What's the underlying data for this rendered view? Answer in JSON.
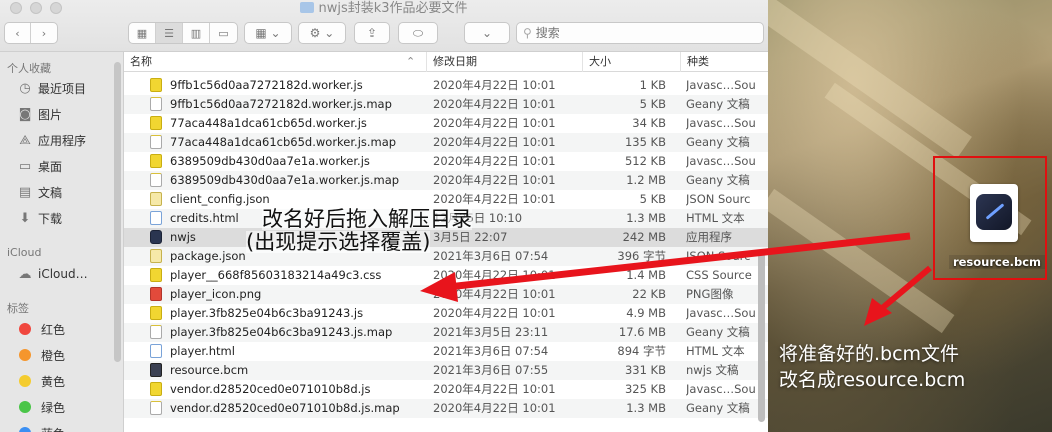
{
  "window": {
    "title": "nwjs封装k3作品必要文件",
    "search_placeholder": "搜索",
    "toolbar_icons": [
      "back-icon",
      "forward-icon",
      "icon-view-icon",
      "list-view-icon",
      "column-view-icon",
      "gallery-view-icon",
      "group-icon",
      "action-gear-icon",
      "share-icon",
      "tag-icon"
    ]
  },
  "sidebar": {
    "favorites_header": "个人收藏",
    "favorites": [
      {
        "label": "最近项目",
        "icon": "clock-icon"
      },
      {
        "label": "图片",
        "icon": "camera-icon"
      },
      {
        "label": "应用程序",
        "icon": "apps-icon"
      },
      {
        "label": "桌面",
        "icon": "desktop-icon"
      },
      {
        "label": "文稿",
        "icon": "document-icon"
      },
      {
        "label": "下载",
        "icon": "download-icon"
      }
    ],
    "icloud_header": "iCloud",
    "icloud_items": [
      {
        "label": "iCloud…",
        "icon": "cloud-icon"
      }
    ],
    "tags_header": "标签",
    "tags": [
      {
        "label": "红色",
        "color": "#f0473e"
      },
      {
        "label": "橙色",
        "color": "#f5962d"
      },
      {
        "label": "黄色",
        "color": "#f4cc2f"
      },
      {
        "label": "绿色",
        "color": "#4ac548"
      },
      {
        "label": "蓝色",
        "color": "#3b8ff3"
      }
    ]
  },
  "columns": {
    "name": "名称",
    "date": "修改日期",
    "size": "大小",
    "kind": "种类"
  },
  "files": [
    {
      "name": "9ffb1c56d0aa7272182d.worker.js",
      "date": "2020年4月22日 10:01",
      "size": "1 KB",
      "kind": "Javasc…Sou",
      "icon": "js"
    },
    {
      "name": "9ffb1c56d0aa7272182d.worker.js.map",
      "date": "2020年4月22日 10:01",
      "size": "5 KB",
      "kind": "Geany 文稿",
      "icon": "map"
    },
    {
      "name": "77aca448a1dca61cb65d.worker.js",
      "date": "2020年4月22日 10:01",
      "size": "34 KB",
      "kind": "Javasc…Sou",
      "icon": "js"
    },
    {
      "name": "77aca448a1dca61cb65d.worker.js.map",
      "date": "2020年4月22日 10:01",
      "size": "135 KB",
      "kind": "Geany 文稿",
      "icon": "map"
    },
    {
      "name": "6389509db430d0aa7e1a.worker.js",
      "date": "2020年4月22日 10:01",
      "size": "512 KB",
      "kind": "Javasc…Sou",
      "icon": "js"
    },
    {
      "name": "6389509db430d0aa7e1a.worker.js.map",
      "date": "2020年4月22日 10:01",
      "size": "1.2 MB",
      "kind": "Geany 文稿",
      "icon": "map"
    },
    {
      "name": "client_config.json",
      "date": "2020年4月22日 10:01",
      "size": "5 KB",
      "kind": "JSON Sourc",
      "icon": "json"
    },
    {
      "name": "credits.html",
      "date": "12月25日 10:10",
      "size": "1.3 MB",
      "kind": "HTML 文本",
      "icon": "html"
    },
    {
      "name": "nwjs",
      "date": "3月5日 22:07",
      "size": "242 MB",
      "kind": "应用程序",
      "icon": "app"
    },
    {
      "name": "package.json",
      "date": "2021年3月6日 07:54",
      "size": "396 字节",
      "kind": "JSON Sourc",
      "icon": "json"
    },
    {
      "name": "player__668f85603183214a49c3.css",
      "date": "2020年4月22日 10:01",
      "size": "1.4 MB",
      "kind": "CSS Source",
      "icon": "css"
    },
    {
      "name": "player_icon.png",
      "date": "2020年4月22日 10:01",
      "size": "22 KB",
      "kind": "PNG图像",
      "icon": "png"
    },
    {
      "name": "player.3fb825e04b6c3ba91243.js",
      "date": "2020年4月22日 10:01",
      "size": "4.9 MB",
      "kind": "Javasc…Sou",
      "icon": "js"
    },
    {
      "name": "player.3fb825e04b6c3ba91243.js.map",
      "date": "2021年3月5日 23:11",
      "size": "17.6 MB",
      "kind": "Geany 文稿",
      "icon": "map"
    },
    {
      "name": "player.html",
      "date": "2021年3月6日 07:54",
      "size": "894 字节",
      "kind": "HTML 文本",
      "icon": "html"
    },
    {
      "name": "resource.bcm",
      "date": "2021年3月6日 07:55",
      "size": "331 KB",
      "kind": "nwjs 文稿",
      "icon": "bcm"
    },
    {
      "name": "vendor.d28520ced0e071010b8d.js",
      "date": "2020年4月22日 10:01",
      "size": "325 KB",
      "kind": "Javasc…Sou",
      "icon": "js"
    },
    {
      "name": "vendor.d28520ced0e071010b8d.js.map",
      "date": "2020年4月22日 10:01",
      "size": "1.3 MB",
      "kind": "Geany 文稿",
      "icon": "map"
    }
  ],
  "annotations": {
    "drag_line1": "改名好后拖入解压目录",
    "drag_line2": "(出现提示选择覆盖)",
    "rename_line1": "将准备好的.bcm文件",
    "rename_line2": "改名成resource.bcm",
    "arrow_color": "#e8141c"
  },
  "desktop": {
    "file_label": "resource.bcm",
    "file_icon": "bcm-file-icon"
  }
}
